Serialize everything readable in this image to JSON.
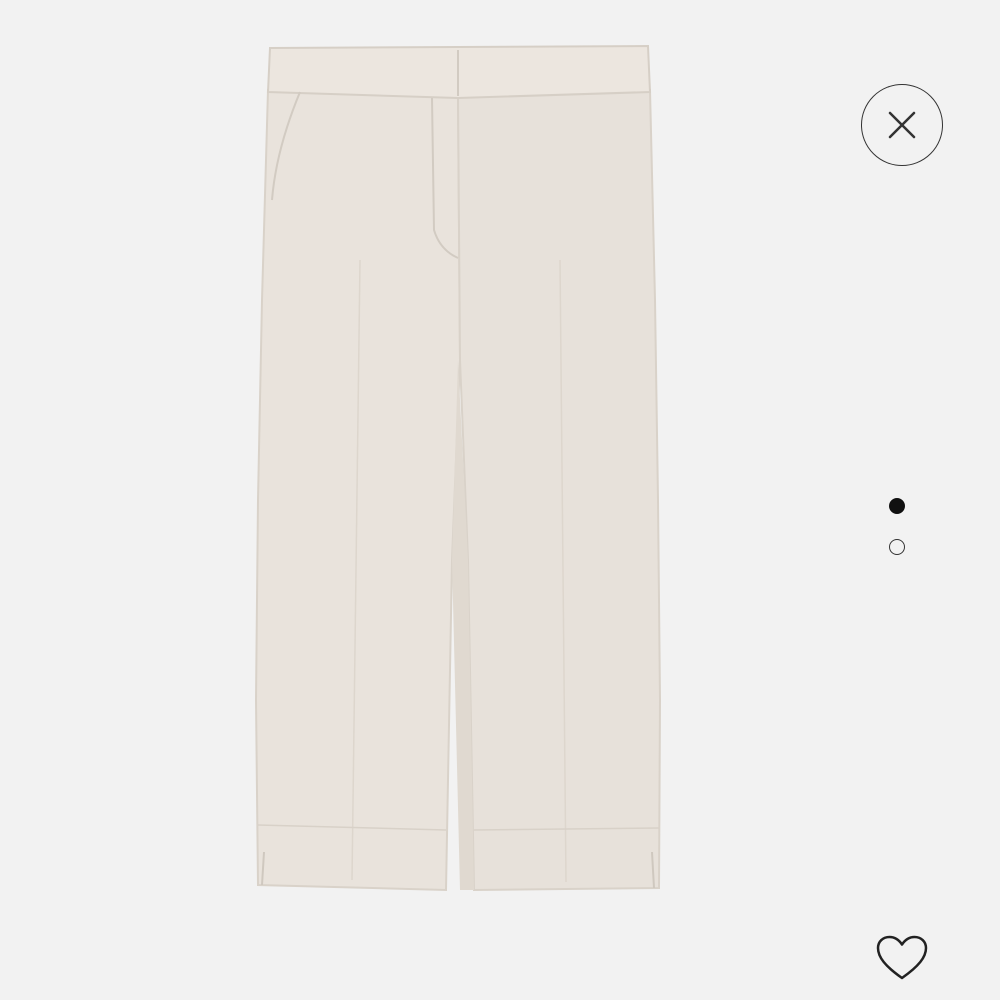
{
  "viewer": {
    "product_image": "cropped-linen-trousers",
    "product_color": "#e9e3dc",
    "background_color": "#f2f2f2",
    "close_icon": "close-icon",
    "favorite_icon": "heart-outline-icon",
    "pager": {
      "total_images": 2,
      "current_image": 1
    }
  }
}
